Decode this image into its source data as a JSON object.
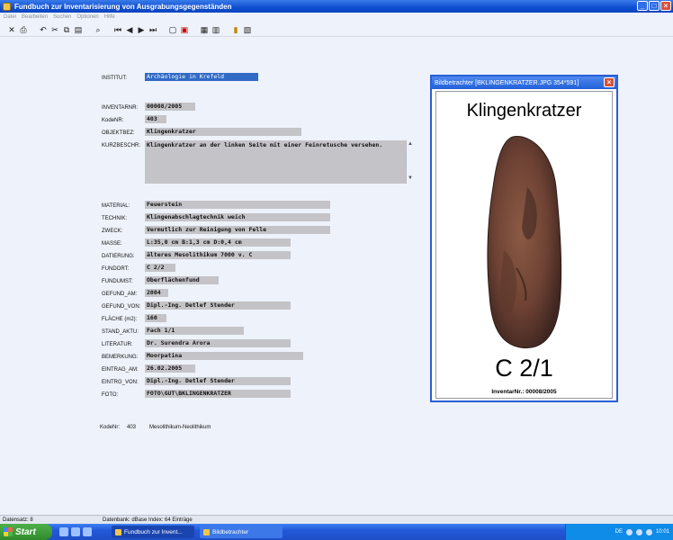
{
  "window": {
    "title": "Fundbuch zur Inventarisierung von Ausgrabungsgegenständen"
  },
  "menu": [
    "Datei",
    "Bearbeiten",
    "Suchen",
    "Optionen",
    "Hilfe"
  ],
  "toolbar_icons": [
    "close-icon",
    "print-icon",
    "undo-icon",
    "cut-icon",
    "copy-icon",
    "paste-icon",
    "find-icon",
    "first-record-icon",
    "previous-record-icon",
    "next-record-icon",
    "last-record-icon",
    "new-record-icon",
    "delete-record-icon",
    "image-icon",
    "table-icon",
    "notes-icon",
    "export-icon"
  ],
  "form": {
    "institut": {
      "label": "INSTITUT:",
      "value": "Archäologie in Krefeld"
    },
    "inventarnr": {
      "label": "INVENTARNR:",
      "value": "00008/2005"
    },
    "kodenr": {
      "label": "KodeNR:",
      "value": "403"
    },
    "objektbez": {
      "label": "OBJEKTBEZ:",
      "value": "Klingenkratzer"
    },
    "kurzbeschr": {
      "label": "KURZBESCHR:",
      "value": "Klingenkratzer an der linken Seite mit einer Feinretusche versehen."
    },
    "material": {
      "label": "MATERIAL:",
      "value": "Feuerstein"
    },
    "technik": {
      "label": "TECHNIK:",
      "value": "Klingenabschlagtechnik weich"
    },
    "zweck": {
      "label": "ZWECK:",
      "value": "Vermutlich zur Reinigung von Felle"
    },
    "masse": {
      "label": "MASSE:",
      "value": "L:35,0 cm B:1,3 cm D:0,4 cm"
    },
    "datierung": {
      "label": "DATIERUNG:",
      "value": "älteres Mesolithikum 7000 v. C"
    },
    "fundort": {
      "label": "FUNDORT:",
      "value": "C 2/2"
    },
    "fundumst": {
      "label": "FUNDUMST:",
      "value": "Oberflächenfund"
    },
    "gefund_am": {
      "label": "GEFUND_AM:",
      "value": "2004"
    },
    "gefund_von": {
      "label": "GEFUND_VON:",
      "value": "Dipl.-Ing. Detlef Stender"
    },
    "flaeche": {
      "label": "FLÄCHE (m2):",
      "value": "160"
    },
    "stand_aktu": {
      "label": "STAND_AKTU:",
      "value": "Fach 1/1"
    },
    "literatur": {
      "label": "LITERATUR:",
      "value": "Dr. Surendra Arora"
    },
    "bemerkung": {
      "label": "BEMERKUNG:",
      "value": "Moorpatina"
    },
    "eintrag_am": {
      "label": "EINTRAG_AM:",
      "value": "26.02.2005"
    },
    "eintrg_von": {
      "label": "EINTRG_VON:",
      "value": "Dipl.-Ing. Detlef Stender"
    },
    "foto": {
      "label": "FOTO:",
      "value": "FOTO\\GUT\\BKLINGENKRATZER"
    },
    "footer_kode_label": "KodeNr:",
    "footer_kode_value": "403",
    "footer_period": "Mesolithikum-Neolithikum"
  },
  "viewer": {
    "title": "Bildbetrachter [BKLINGENKRATZER.JPG 354*591]",
    "heading": "Klingenkratzer",
    "code": "C 2/1",
    "inventar_line": "InventarNr.: 00008/2005"
  },
  "status": {
    "record": "Datensatz: 8",
    "db_info": "Datenbank: dBase  Index: 64 Einträge"
  },
  "taskbar": {
    "start": "Start",
    "task1": "Fundbuch zur Invent...",
    "task2": "Bildbetrachter",
    "lang": "DE",
    "time": "10:01"
  },
  "colors": {
    "titlebar": "#0f4fd0",
    "selection": "#316ac5",
    "field_bg": "#c4c4c8",
    "close": "#d9513c"
  }
}
